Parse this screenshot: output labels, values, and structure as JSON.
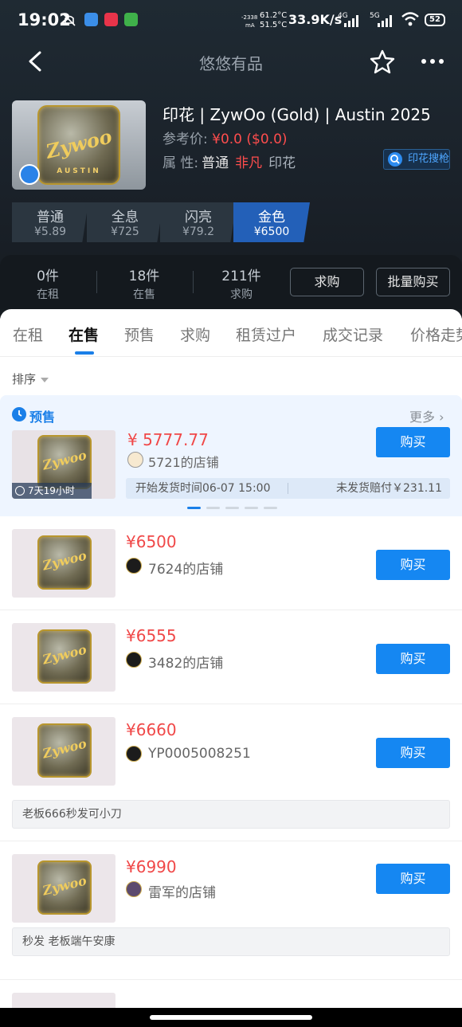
{
  "status_bar": {
    "time": "19:02",
    "current": "-2338",
    "current_unit": "mA",
    "temp1": "61.2°C",
    "temp2": "51.5°C",
    "speed": "33.9K/s",
    "net1": "4G",
    "net2": "5G",
    "battery": "52"
  },
  "nav": {
    "title": "悠悠有品"
  },
  "product": {
    "name": "印花 | ZywOo (Gold) | Austin 2025",
    "ref_label": "参考价:",
    "ref_price": "¥0.0  ($0.0)",
    "attr_label": "属 性:",
    "attr_normal": "普通",
    "attr_rarity": "非凡",
    "attr_type": "印花",
    "search_button": "印花搜枪",
    "sticker_word": "Zywoo",
    "sticker_sub": "AUSTIN"
  },
  "variants": [
    {
      "name": "普通",
      "price": "¥5.89"
    },
    {
      "name": "全息",
      "price": "¥725"
    },
    {
      "name": "闪亮",
      "price": "¥79.2"
    },
    {
      "name": "金色",
      "price": "¥6500"
    }
  ],
  "counts": [
    {
      "value": "0件",
      "label": "在租"
    },
    {
      "value": "18件",
      "label": "在售"
    },
    {
      "value": "211件",
      "label": "求购"
    }
  ],
  "actions": {
    "buy_request": "求购",
    "bulk_buy": "批量购买"
  },
  "tabs": [
    "在租",
    "在售",
    "预售",
    "求购",
    "租赁过户",
    "成交记录",
    "价格走势"
  ],
  "sort_label": "排序",
  "presale": {
    "title": "预售",
    "more": "更多",
    "countdown": "7天19小时",
    "price": "¥ 5777.77",
    "shop": "5721的店铺",
    "ship_time": "开始发货时间06-07 15:00",
    "compensation": "未发货赔付￥231.11",
    "buy": "购买"
  },
  "listings": [
    {
      "price": "¥6500",
      "shop": "7624的店铺",
      "buy": "购买",
      "note": ""
    },
    {
      "price": "¥6555",
      "shop": "3482的店铺",
      "buy": "购买",
      "note": ""
    },
    {
      "price": "¥6660",
      "shop": "YP0005008251",
      "buy": "购买",
      "note": "老板666秒发可小刀"
    },
    {
      "price": "¥6990",
      "shop": "雷军的店铺",
      "buy": "购买",
      "note": "秒发 老板端午安康"
    }
  ],
  "colors": {
    "accent": "#1587f2",
    "price": "#f04848",
    "header_bg": "#1f2a33"
  }
}
